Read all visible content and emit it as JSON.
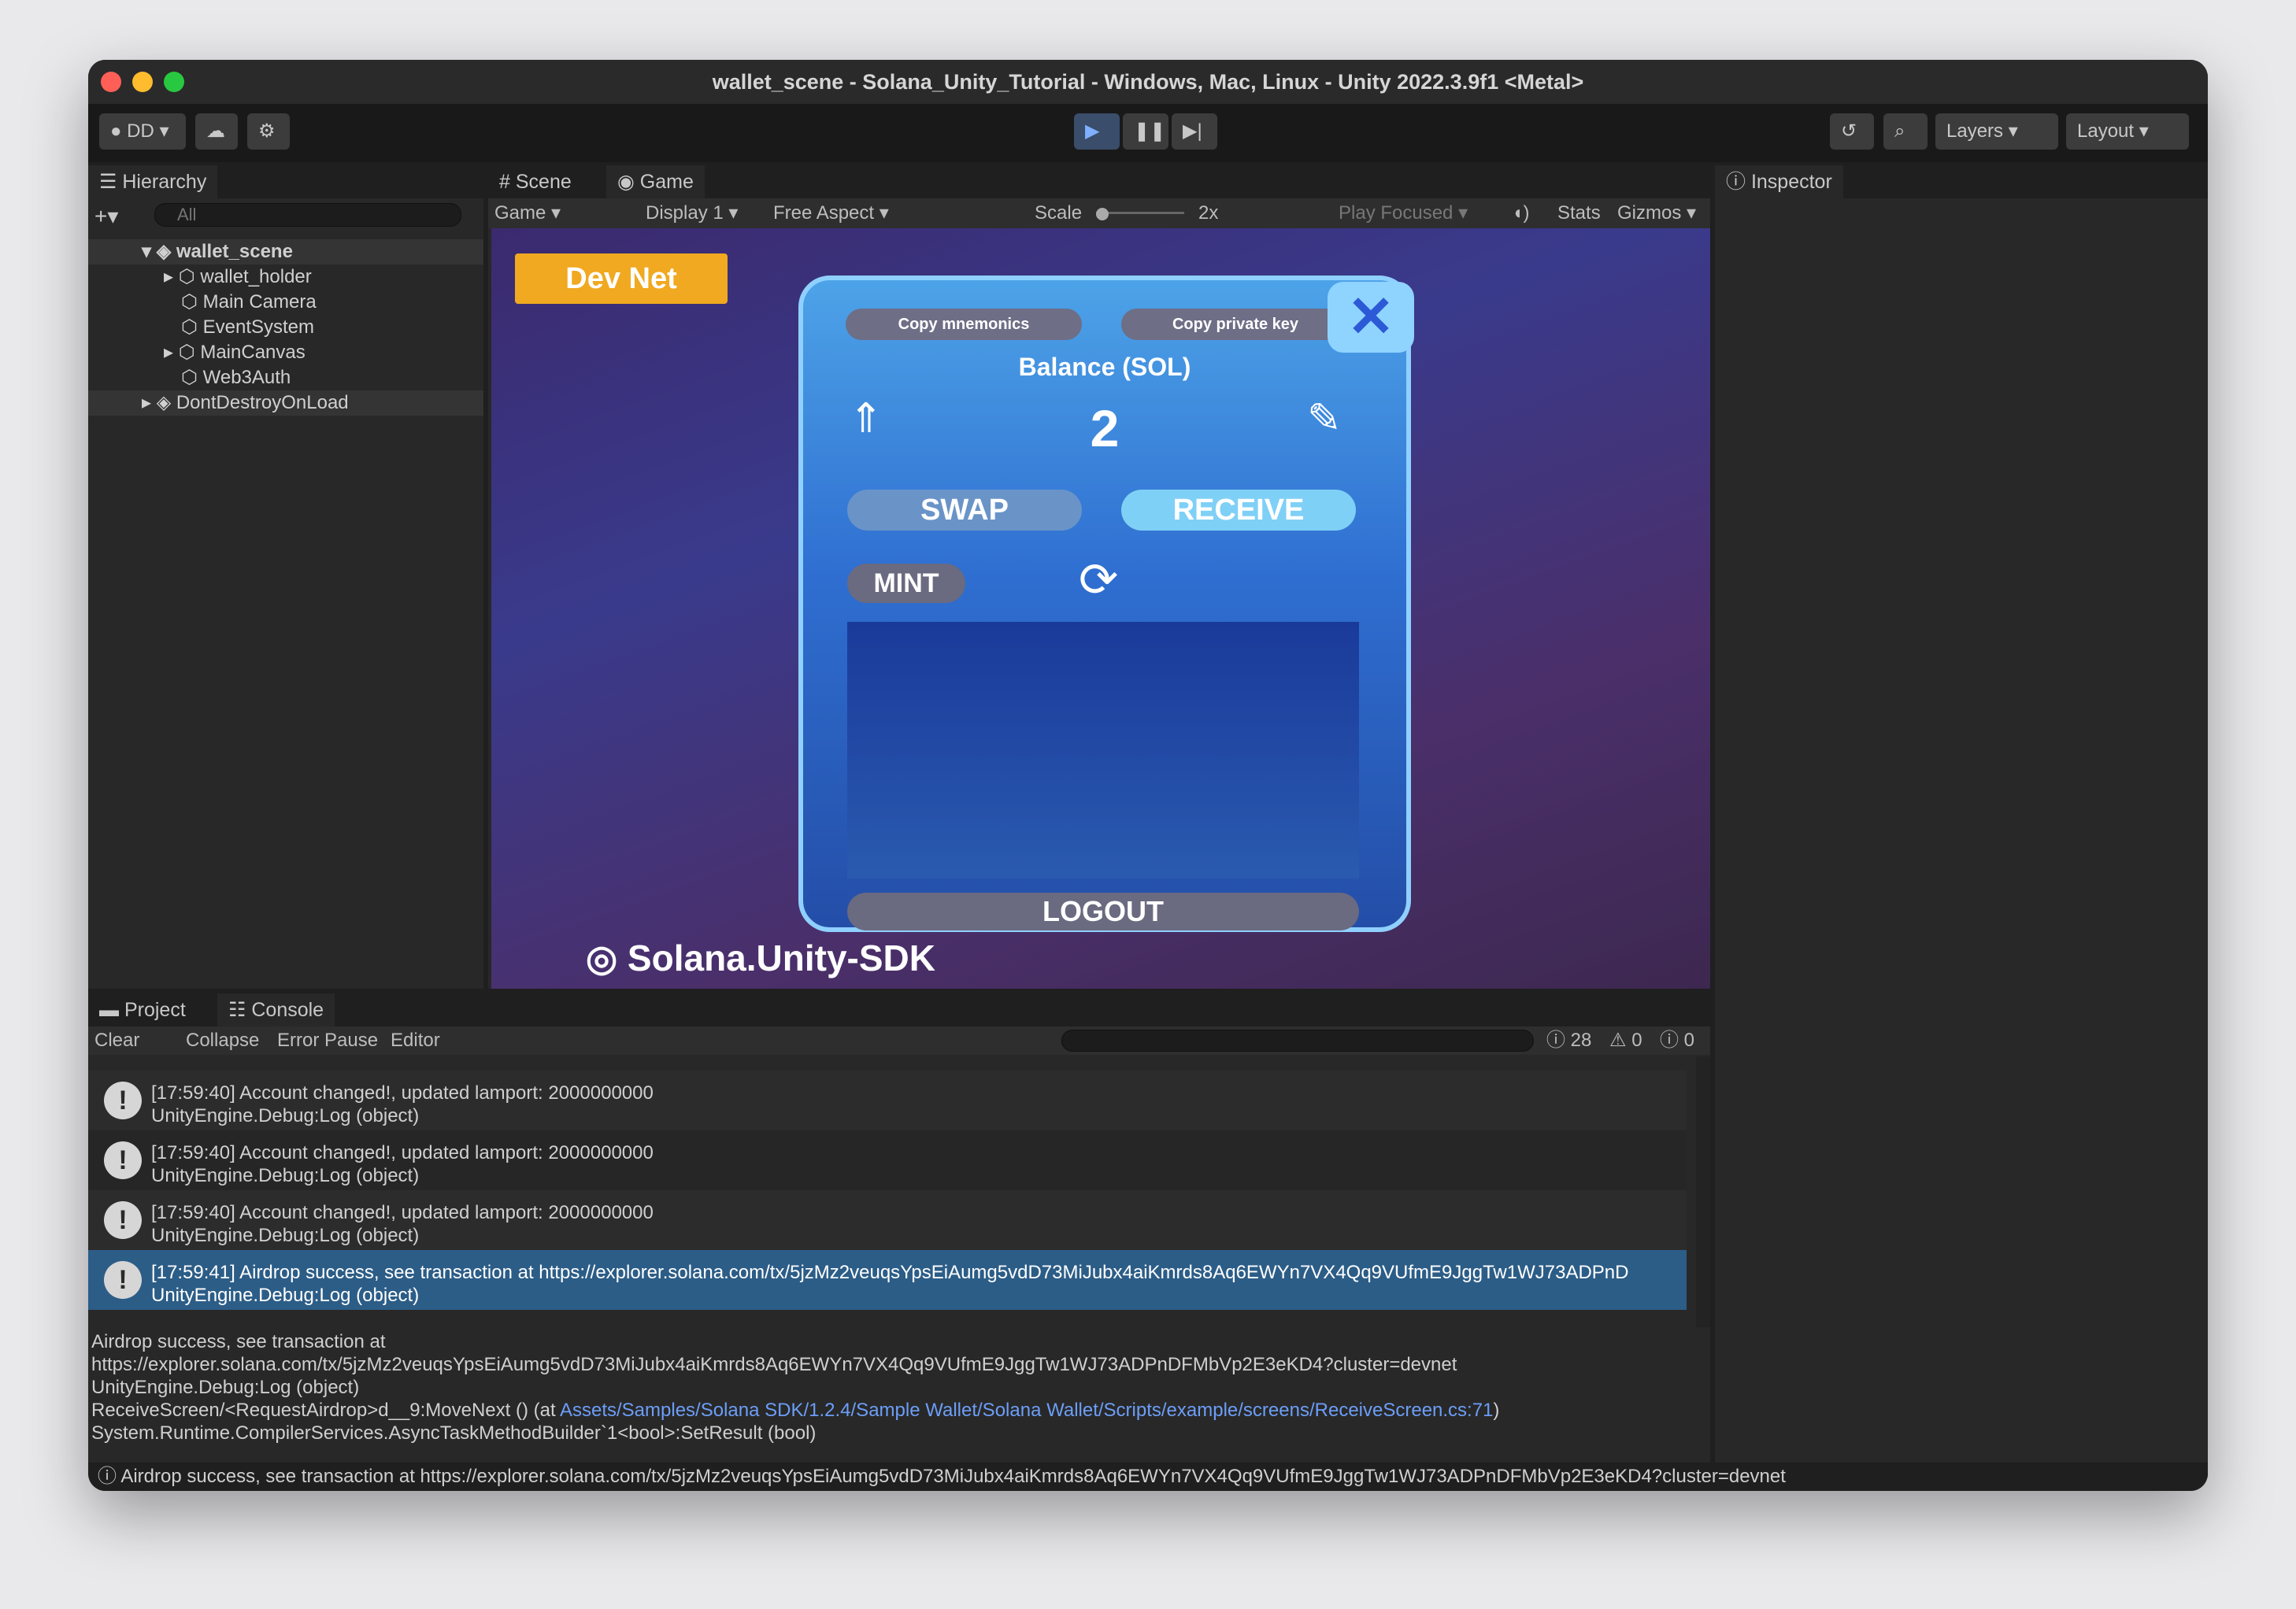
{
  "window": {
    "title": "wallet_scene - Solana_Unity_Tutorial - Windows, Mac, Linux - Unity 2022.3.9f1 <Metal>"
  },
  "toolbar": {
    "account": "DD",
    "layers": "Layers",
    "layout": "Layout"
  },
  "hierarchy": {
    "tab": "Hierarchy",
    "search_placeholder": "All",
    "scene": "wallet_scene",
    "items": [
      "wallet_holder",
      "Main Camera",
      "EventSystem",
      "MainCanvas",
      "Web3Auth"
    ],
    "ddol": "DontDestroyOnLoad"
  },
  "scene_tab": "Scene",
  "game_tab": "Game",
  "game_toolbar": {
    "view": "Game",
    "display": "Display 1",
    "aspect": "Free Aspect",
    "scale_label": "Scale",
    "scale_value": "2x",
    "play_focused": "Play Focused",
    "stats": "Stats",
    "gizmos": "Gizmos"
  },
  "game": {
    "network": "Dev Net",
    "copy_mnemonics": "Copy mnemonics",
    "copy_private_key": "Copy private key",
    "balance_label": "Balance (SOL)",
    "balance": "2",
    "swap": "SWAP",
    "receive": "RECEIVE",
    "mint": "MINT",
    "logout": "LOGOUT",
    "sdk_logo": "Solana.Unity-SDK"
  },
  "inspector": {
    "tab": "Inspector"
  },
  "bottom_tabs": {
    "project": "Project",
    "console": "Console"
  },
  "console_toolbar": {
    "clear": "Clear",
    "collapse": "Collapse",
    "error_pause": "Error Pause",
    "editor": "Editor",
    "count_info": "28",
    "count_warn": "0",
    "count_err": "0"
  },
  "logs": [
    {
      "line1": "[17:59:40] Account changed!, updated lamport: 2000000000",
      "line2": "UnityEngine.Debug:Log (object)"
    },
    {
      "line1": "[17:59:40] Account changed!, updated lamport: 2000000000",
      "line2": "UnityEngine.Debug:Log (object)"
    },
    {
      "line1": "[17:59:40] Account changed!, updated lamport: 2000000000",
      "line2": "UnityEngine.Debug:Log (object)"
    },
    {
      "line1": "[17:59:41] Airdrop success, see transaction at https://explorer.solana.com/tx/5jzMz2veuqsYpsEiAumg5vdD73MiJubx4aiKmrds8Aq6EWYn7VX4Qq9VUfmE9JggTw1WJ73ADPnD",
      "line2": "UnityEngine.Debug:Log (object)"
    }
  ],
  "detail": {
    "line1": "Airdrop success, see transaction at",
    "line2": "https://explorer.solana.com/tx/5jzMz2veuqsYpsEiAumg5vdD73MiJubx4aiKmrds8Aq6EWYn7VX4Qq9VUfmE9JggTw1WJ73ADPnDFMbVp2E3eKD4?cluster=devnet",
    "line3": "UnityEngine.Debug:Log (object)",
    "line4_prefix": "ReceiveScreen/<RequestAirdrop>d__9:MoveNext () (at ",
    "line4_link": "Assets/Samples/Solana SDK/1.2.4/Sample Wallet/Solana Wallet/Scripts/example/screens/ReceiveScreen.cs:71",
    "line4_suffix": ")",
    "line5": "System.Runtime.CompilerServices.AsyncTaskMethodBuilder`1<bool>:SetResult (bool)"
  },
  "statusbar": "Airdrop success, see transaction at https://explorer.solana.com/tx/5jzMz2veuqsYpsEiAumg5vdD73MiJubx4aiKmrds8Aq6EWYn7VX4Qq9VUfmE9JggTw1WJ73ADPnDFMbVp2E3eKD4?cluster=devnet"
}
